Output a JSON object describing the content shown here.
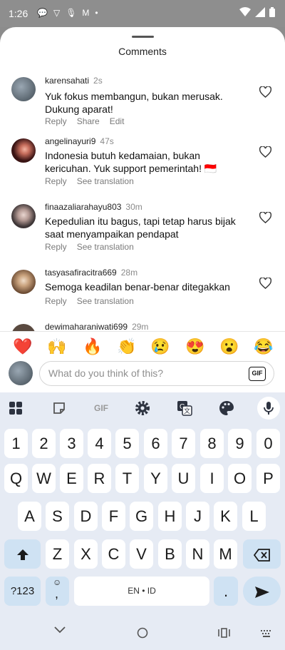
{
  "status": {
    "time": "1:26"
  },
  "sheet": {
    "title": "Comments"
  },
  "comments": [
    {
      "user": "karensahati",
      "time": "2s",
      "text": "Yuk fokus membangun, bukan merusak. Dukung aparat!",
      "actions": [
        "Reply",
        "Share",
        "Edit"
      ]
    },
    {
      "user": "angelinayuri9",
      "time": "47s",
      "text": "Indonesia butuh kedamaian, bukan kericuhan. Yuk support pemerintah! 🇮🇩",
      "actions": [
        "Reply",
        "See translation"
      ]
    },
    {
      "user": "finaazaliarahayu803",
      "time": "30m",
      "text": "Kepedulian itu bagus, tapi tetap harus bijak saat menyampaikan pendapat",
      "actions": [
        "Reply",
        "See translation"
      ]
    },
    {
      "user": "tasyasafiracitra669",
      "time": "28m",
      "text": "Semoga keadilan benar-benar ditegakkan",
      "actions": [
        "Reply",
        "See translation"
      ]
    },
    {
      "user": "dewimaharaniwati699",
      "time": "29m",
      "text": "",
      "actions": []
    }
  ],
  "emojis": [
    "❤️",
    "🙌",
    "🔥",
    "👏",
    "😢",
    "😍",
    "😮",
    "😂"
  ],
  "input": {
    "placeholder": "What do you think of this?",
    "gif": "GIF"
  },
  "keyboard": {
    "toolbar_gif": "GIF",
    "row_numbers": [
      "1",
      "2",
      "3",
      "4",
      "5",
      "6",
      "7",
      "8",
      "9",
      "0"
    ],
    "row1": [
      "Q",
      "W",
      "E",
      "R",
      "T",
      "Y",
      "U",
      "I",
      "O",
      "P"
    ],
    "row2": [
      "A",
      "S",
      "D",
      "F",
      "G",
      "H",
      "J",
      "K",
      "L"
    ],
    "row3": [
      "Z",
      "X",
      "C",
      "V",
      "B",
      "N",
      "M"
    ],
    "symbols_key": "?123",
    "comma_key": ",",
    "space_label": "EN • ID",
    "period_key": "."
  }
}
